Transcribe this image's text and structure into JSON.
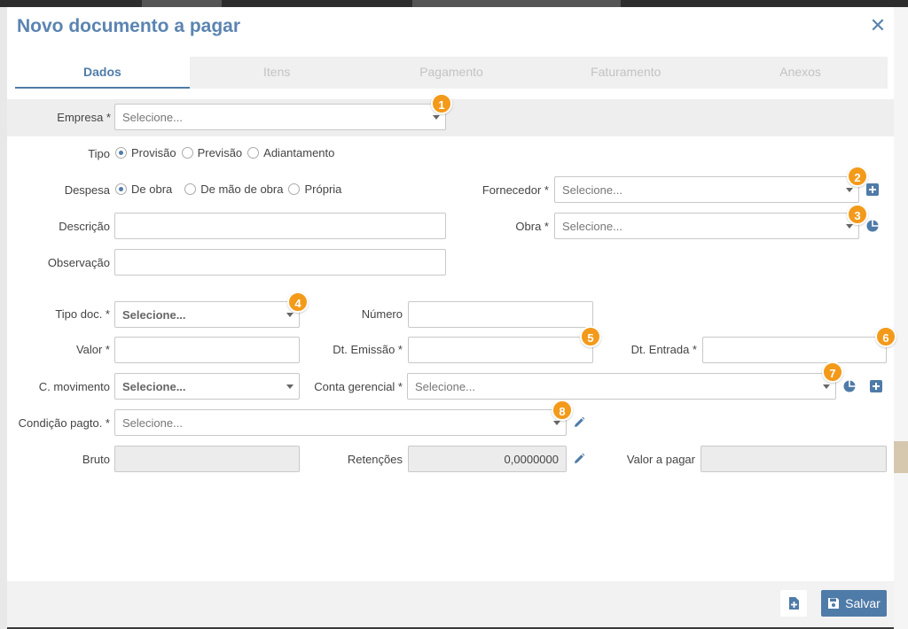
{
  "modal": {
    "title": "Novo documento a pagar",
    "close_icon": "close-icon"
  },
  "tabs": [
    {
      "label": "Dados",
      "active": true
    },
    {
      "label": "Itens",
      "active": false
    },
    {
      "label": "Pagamento",
      "active": false
    },
    {
      "label": "Faturamento",
      "active": false
    },
    {
      "label": "Anexos",
      "active": false
    }
  ],
  "form": {
    "empresa": {
      "label": "Empresa *",
      "placeholder": "Selecione..."
    },
    "tipo": {
      "label": "Tipo",
      "options": [
        "Provisão",
        "Previsão",
        "Adiantamento"
      ],
      "selected": "Provisão"
    },
    "despesa": {
      "label": "Despesa",
      "options": [
        "De obra",
        "De mão de obra",
        "Própria"
      ],
      "selected": "De obra"
    },
    "fornecedor": {
      "label": "Fornecedor *",
      "placeholder": "Selecione..."
    },
    "descricao": {
      "label": "Descrição",
      "value": ""
    },
    "obra": {
      "label": "Obra *",
      "placeholder": "Selecione..."
    },
    "observacao": {
      "label": "Observação",
      "value": ""
    },
    "tipo_doc": {
      "label": "Tipo doc. *",
      "placeholder": "Selecione..."
    },
    "numero": {
      "label": "Número",
      "value": ""
    },
    "valor": {
      "label": "Valor *",
      "value": ""
    },
    "dt_emissao": {
      "label": "Dt. Emissão *",
      "value": ""
    },
    "dt_entrada": {
      "label": "Dt. Entrada *",
      "value": ""
    },
    "c_movimento": {
      "label": "C. movimento",
      "placeholder": "Selecione..."
    },
    "conta_gerencial": {
      "label": "Conta gerencial *",
      "placeholder": "Selecione..."
    },
    "condicao_pagto": {
      "label": "Condição pagto. *",
      "placeholder": "Selecione..."
    },
    "bruto": {
      "label": "Bruto",
      "value": ""
    },
    "retencoes": {
      "label": "Retenções",
      "value": "0,0000000"
    },
    "valor_a_pagar": {
      "label": "Valor a pagar",
      "value": ""
    }
  },
  "badges": [
    "1",
    "2",
    "3",
    "4",
    "5",
    "6",
    "7",
    "8"
  ],
  "footer": {
    "save_label": "Salvar",
    "save_icon": "floppy-disk-icon",
    "new_doc_icon": "document-plus-icon"
  },
  "colors": {
    "accent": "#4f7ba8",
    "title": "#5b84b1",
    "badge": "#f39a1a"
  }
}
